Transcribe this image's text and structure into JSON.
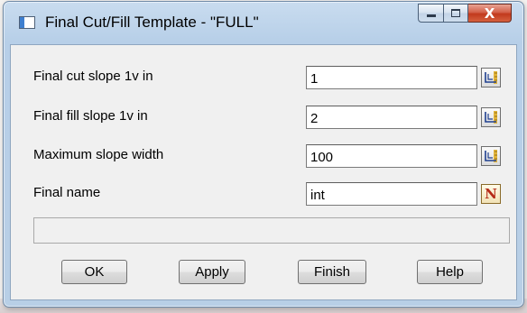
{
  "window": {
    "title": "Final Cut/Fill Template - \"FULL\"",
    "close_glyph": "X"
  },
  "fields": [
    {
      "label": "Final cut slope  1v in",
      "value": "1",
      "button_icon": "pick-icon"
    },
    {
      "label": "Final fill slope 1v in",
      "value": "2",
      "button_icon": "pick-icon"
    },
    {
      "label": "Maximum slope width",
      "value": "100",
      "button_icon": "pick-icon"
    },
    {
      "label": "Final name",
      "value": "int",
      "button_icon": "name-n-icon",
      "button_glyph": "N"
    }
  ],
  "status": {
    "text": ""
  },
  "buttons": {
    "ok": "OK",
    "apply": "Apply",
    "finish": "Finish",
    "help": "Help"
  },
  "colors": {
    "frame": "#b8cfe6",
    "close_button": "#c2391d",
    "n_glyph": "#b52a17"
  }
}
